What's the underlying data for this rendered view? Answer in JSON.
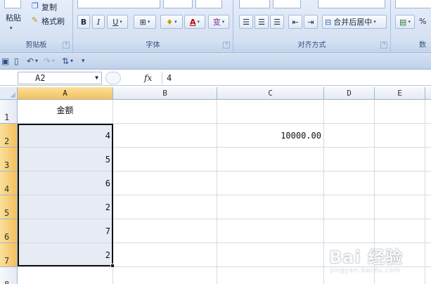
{
  "ribbon": {
    "clipboard": {
      "paste": "粘贴",
      "copy": "复制",
      "format_painter": "格式刷",
      "label": "剪贴板"
    },
    "font": {
      "label": "字体",
      "bold": "B",
      "italic": "I",
      "underline": "U",
      "font_color": "A",
      "phonetic": "变"
    },
    "alignment": {
      "label": "对齐方式",
      "merge_center": "合并后居中"
    },
    "number": {
      "label": "数",
      "percent": "%"
    },
    "launcher_glyph": "⌝"
  },
  "quick_access": {
    "customize": "▾"
  },
  "formula_bar": {
    "name_box": "A2",
    "fx": "fx",
    "content": "4"
  },
  "sheet": {
    "columns": [
      "A",
      "B",
      "C",
      "D",
      "E"
    ],
    "rows": [
      "1",
      "2",
      "3",
      "4",
      "5",
      "6",
      "7",
      "8"
    ],
    "cells": {
      "A1": "金额",
      "A2": "4",
      "A3": "5",
      "A4": "6",
      "A5": "2",
      "A6": "7",
      "A7": "2",
      "C2": "10000.00"
    }
  },
  "watermark": {
    "logo": "Bai 经验",
    "url": "jingyan.baidu.com"
  },
  "colors": {
    "ribbon_bg": "#dbe6f6",
    "active_header": "#f3bf5d",
    "selection_fill": "#e6ebf4",
    "selection_border": "#111111"
  }
}
